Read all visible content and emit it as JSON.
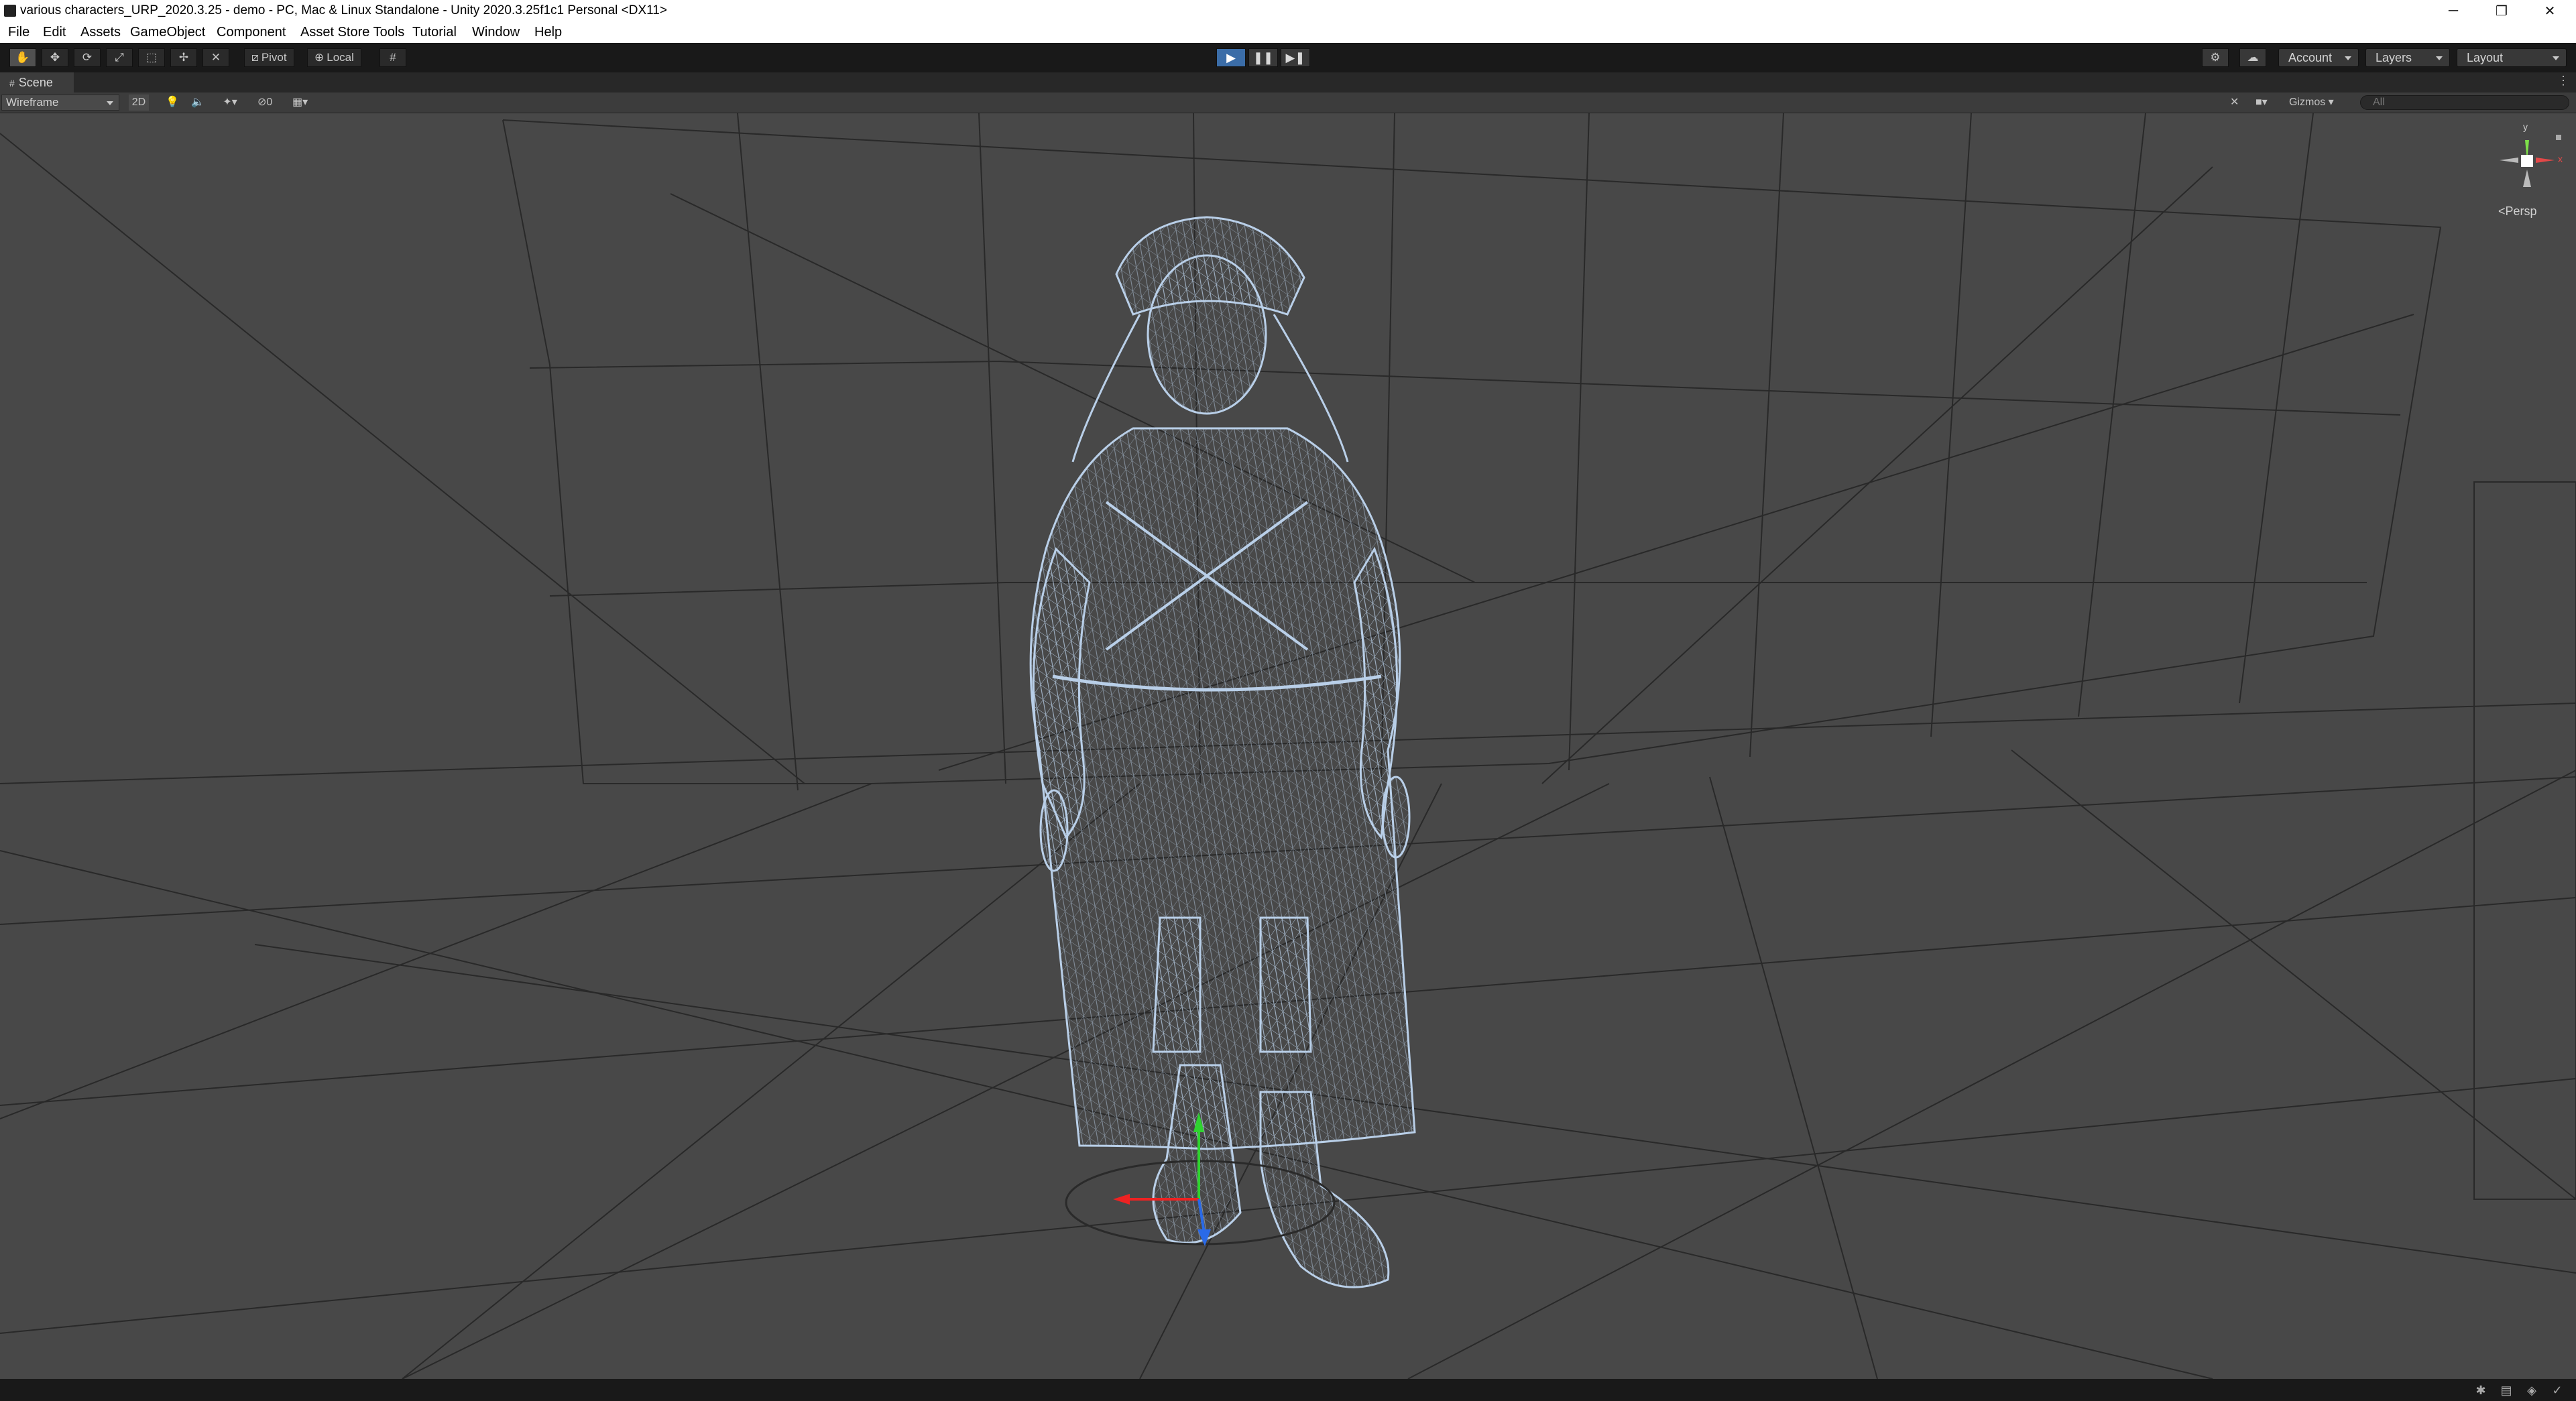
{
  "window": {
    "title": "various characters_URP_2020.3.25 - demo - PC, Mac & Linux Standalone - Unity 2020.3.25f1c1 Personal <DX11>",
    "controls": [
      "─",
      "❐",
      "✕"
    ]
  },
  "menu": [
    "File",
    "Edit",
    "Assets",
    "GameObject",
    "Component",
    "Asset Store Tools",
    "Tutorial",
    "Window",
    "Help"
  ],
  "toolbar": {
    "tools": [
      "hand-tool-icon",
      "move-tool-icon",
      "rotate-tool-icon",
      "scale-tool-icon",
      "rect-tool-icon",
      "transform-tool-icon",
      "custom-tool-icon"
    ],
    "pivot_label": "Pivot",
    "local_label": "Local",
    "play_state": "playing",
    "account_label": "Account",
    "layers_label": "Layers",
    "layout_label": "Layout"
  },
  "scene_tab": {
    "label": "Scene"
  },
  "scene_toolbar": {
    "draw_mode": "Wireframe",
    "mode_2d": "2D",
    "hidden_count": "0",
    "gizmos_label": "Gizmos",
    "search_placeholder": "All"
  },
  "scene_gizmo": {
    "projection_label": "Persp",
    "axes": [
      "y",
      "x"
    ]
  },
  "colors": {
    "wire": "#b9cfe8",
    "viewport": "#484848",
    "play_active": "#3b6da8"
  }
}
